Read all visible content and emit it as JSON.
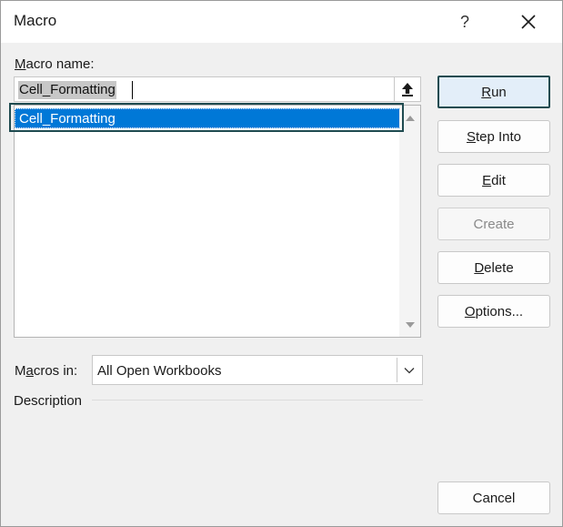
{
  "window": {
    "title": "Macro",
    "help_label": "?"
  },
  "macro_name": {
    "label_mnemonic": "M",
    "label_rest": "acro name:",
    "value": "Cell_Formatting"
  },
  "macro_list": {
    "items": [
      {
        "label": "Cell_Formatting",
        "selected": true
      }
    ]
  },
  "macros_in": {
    "label_pre": "M",
    "label_mnemonic": "a",
    "label_rest": "cros in:",
    "selected": "All Open Workbooks"
  },
  "description": {
    "label": "Description"
  },
  "buttons": {
    "run": {
      "mnemonic": "R",
      "rest": "un"
    },
    "step_into": {
      "mnemonic": "S",
      "rest": "tep Into"
    },
    "edit": {
      "mnemonic": "E",
      "rest": "dit"
    },
    "create": {
      "label": "Create"
    },
    "delete": {
      "mnemonic": "D",
      "rest": "elete"
    },
    "options": {
      "mnemonic": "O",
      "rest": "ptions..."
    },
    "cancel": {
      "label": "Cancel"
    }
  },
  "colors": {
    "accent": "#0078d7",
    "focus_border": "#1f4b50"
  }
}
